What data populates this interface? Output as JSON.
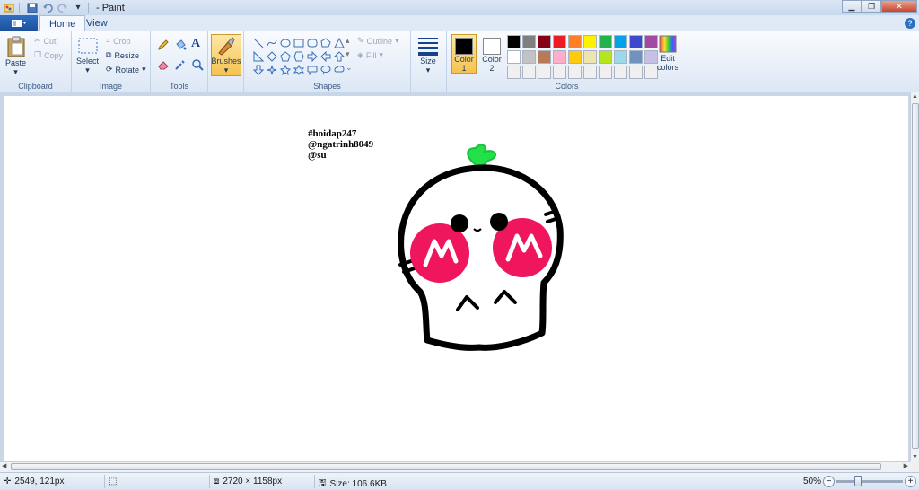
{
  "window": {
    "title": "- Paint"
  },
  "tabs": {
    "file_label": "",
    "home": "Home",
    "view": "View"
  },
  "clipboard": {
    "group": "Clipboard",
    "paste": "Paste",
    "cut": "Cut",
    "copy": "Copy"
  },
  "image": {
    "group": "Image",
    "select": "Select",
    "crop": "Crop",
    "resize": "Resize",
    "rotate": "Rotate"
  },
  "tools": {
    "group": "Tools"
  },
  "brushes": {
    "label": "Brushes"
  },
  "shapes": {
    "group": "Shapes",
    "outline": "Outline",
    "fill": "Fill"
  },
  "size": {
    "label": "Size"
  },
  "colors": {
    "group": "Colors",
    "color1_label": "Color",
    "color1_num": "1",
    "color2_label": "Color",
    "color2_num": "2",
    "edit_label_1": "Edit",
    "edit_label_2": "colors",
    "color1": "#000000",
    "color2": "#ffffff",
    "palette": [
      "#000000",
      "#7f7f7f",
      "#880015",
      "#ed1c24",
      "#ff7f27",
      "#fff200",
      "#22b14c",
      "#00a2e8",
      "#3f48cc",
      "#a349a4",
      "#ffffff",
      "#c3c3c3",
      "#b97a57",
      "#ffaec9",
      "#ffc90e",
      "#efe4b0",
      "#b5e61d",
      "#99d9ea",
      "#7092be",
      "#c8bfe7",
      "#f0f0f0",
      "#f0f0f0",
      "#f0f0f0",
      "#f0f0f0",
      "#f0f0f0",
      "#f0f0f0",
      "#f0f0f0",
      "#f0f0f0",
      "#f0f0f0",
      "#f0f0f0"
    ]
  },
  "canvas": {
    "text_lines": [
      "#hoidap247",
      "@ngatrinh8049",
      "@su"
    ]
  },
  "status": {
    "cursor_pos": "2549, 121px",
    "image_dims": "2720 × 1158px",
    "file_size": "Size: 106.6KB",
    "zoom": "50%",
    "zoom_fraction": 0.3
  }
}
